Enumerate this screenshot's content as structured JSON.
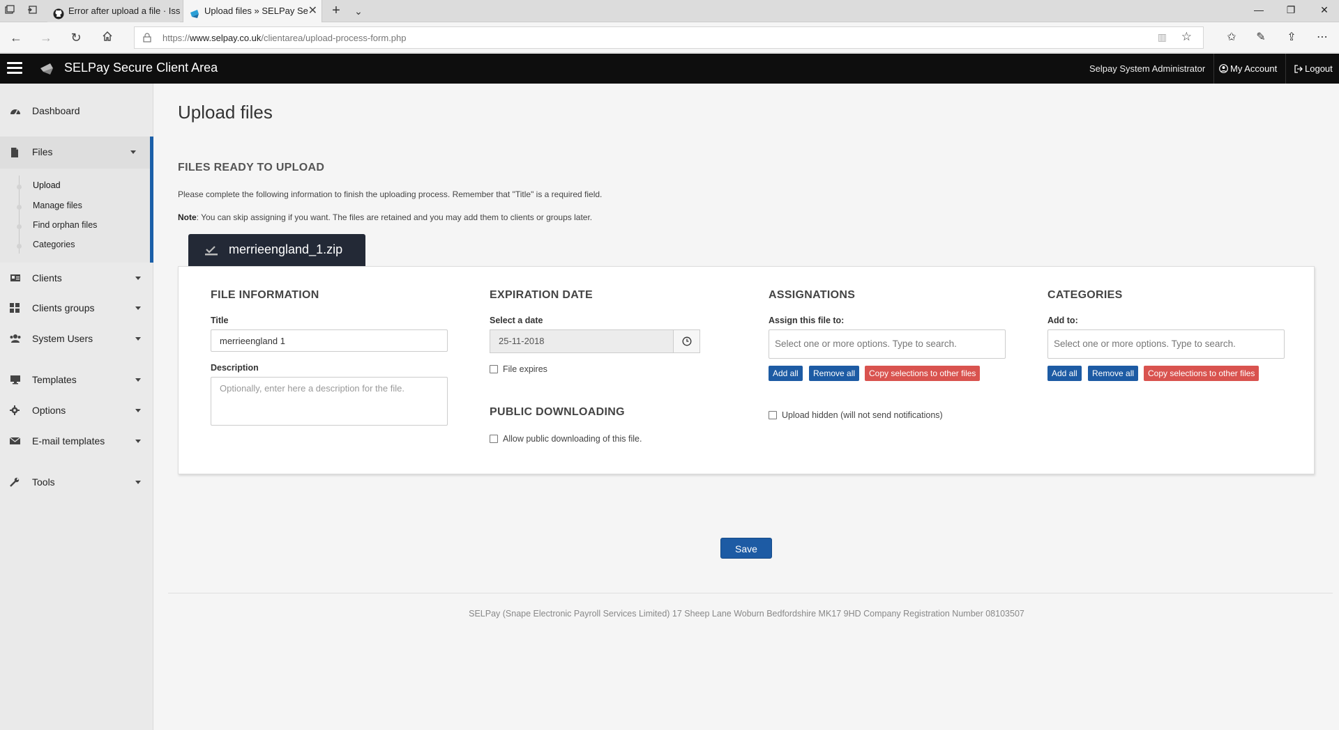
{
  "browser": {
    "tabs": [
      {
        "title": "Error after upload a file · Iss",
        "active": false
      },
      {
        "title": "Upload files » SELPay Se",
        "active": true
      }
    ],
    "url_prefix": "https://",
    "url_domain": "www.selpay.co.uk",
    "url_path": "/clientarea/upload-process-form.php"
  },
  "header": {
    "brand": "SELPay Secure Client Area",
    "user": "Selpay System Administrator",
    "my_account": "My Account",
    "logout": "Logout"
  },
  "sidebar": {
    "items": [
      {
        "label": "Dashboard",
        "icon": "dashboard-icon"
      },
      {
        "label": "Files",
        "icon": "file-icon"
      },
      {
        "label": "Clients",
        "icon": "clients-icon"
      },
      {
        "label": "Clients groups",
        "icon": "grid-icon"
      },
      {
        "label": "System Users",
        "icon": "users-icon"
      },
      {
        "label": "Templates",
        "icon": "monitor-icon"
      },
      {
        "label": "Options",
        "icon": "gear-icon"
      },
      {
        "label": "E-mail templates",
        "icon": "envelope-icon"
      },
      {
        "label": "Tools",
        "icon": "wrench-icon"
      }
    ],
    "files_sub": [
      "Upload",
      "Manage files",
      "Find orphan files",
      "Categories"
    ]
  },
  "main": {
    "title": "Upload files",
    "section_title": "FILES READY TO UPLOAD",
    "intro": "Please complete the following information to finish the uploading process. Remember that \"Title\" is a required field.",
    "note_label": "Note",
    "note_text": ": You can skip assigning if you want. The files are retained and you may add them to clients or groups later.",
    "file_name": "merrieengland_1.zip",
    "file_info": {
      "heading": "FILE INFORMATION",
      "title_label": "Title",
      "title_value": "merrieengland 1",
      "description_label": "Description",
      "description_placeholder": "Optionally, enter here a description for the file."
    },
    "expiration": {
      "heading": "EXPIRATION DATE",
      "date_label": "Select a date",
      "date_value": "25-11-2018",
      "expires_label": "File expires"
    },
    "public": {
      "heading": "PUBLIC DOWNLOADING",
      "allow_label": "Allow public downloading of this file."
    },
    "assignations": {
      "heading": "ASSIGNATIONS",
      "label": "Assign this file to:",
      "placeholder": "Select one or more options. Type to search.",
      "add_all": "Add all",
      "remove_all": "Remove all",
      "copy": "Copy selections to other files",
      "hidden_label": "Upload hidden (will not send notifications)"
    },
    "categories": {
      "heading": "CATEGORIES",
      "label": "Add to:",
      "placeholder": "Select one or more options. Type to search.",
      "add_all": "Add all",
      "remove_all": "Remove all",
      "copy": "Copy selections to other files"
    },
    "save": "Save",
    "footer": "SELPay (Snape Electronic Payroll Services Limited) 17 Sheep Lane Woburn Bedfordshire MK17 9HD Company Registration Number 08103507"
  },
  "colors": {
    "header_bg": "#0e0e0e",
    "primary_button": "#1d5ba4",
    "danger_button": "#d9534f",
    "sidebar_active_bar": "#1b5fa8",
    "file_tab_bg": "#232936"
  }
}
